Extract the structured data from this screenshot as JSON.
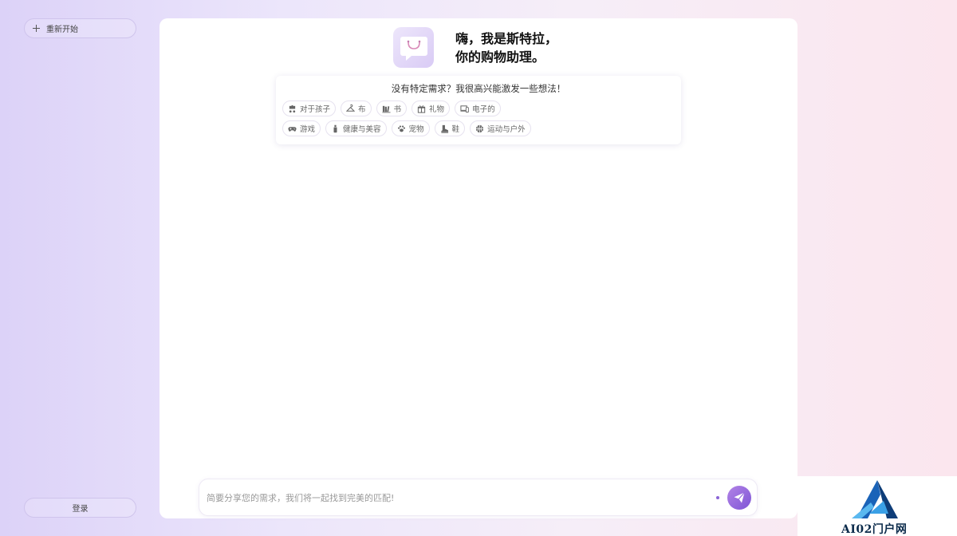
{
  "sidebar": {
    "restart_label": "重新开始",
    "login_label": "登录"
  },
  "hero": {
    "title_line1": "嗨，我是斯特拉，",
    "title_line2": "你的购物助理。"
  },
  "suggestions": {
    "title": "没有特定需求？我很高兴能激发一些想法！",
    "row1": [
      {
        "label": "对于孩子",
        "icon": "baby-carriage-icon"
      },
      {
        "label": "布",
        "icon": "hanger-icon"
      },
      {
        "label": "书",
        "icon": "book-icon"
      },
      {
        "label": "礼物",
        "icon": "gift-icon"
      },
      {
        "label": "电子的",
        "icon": "devices-icon"
      }
    ],
    "row2": [
      {
        "label": "游戏",
        "icon": "gamepad-icon"
      },
      {
        "label": "健康与美容",
        "icon": "bottle-icon"
      },
      {
        "label": "宠物",
        "icon": "paw-icon"
      },
      {
        "label": "鞋",
        "icon": "boot-icon"
      },
      {
        "label": "运动与户外",
        "icon": "basketball-icon"
      }
    ]
  },
  "chat": {
    "placeholder": "简要分享您的需求，我们将一起找到完美的匹配!",
    "value": ""
  },
  "watermark": {
    "text": "AI02门户网"
  },
  "colors": {
    "accent": "#8a64d6",
    "send_gradient_start": "#b283e6",
    "send_gradient_end": "#7e55d6",
    "chip_icon": "#666666"
  }
}
